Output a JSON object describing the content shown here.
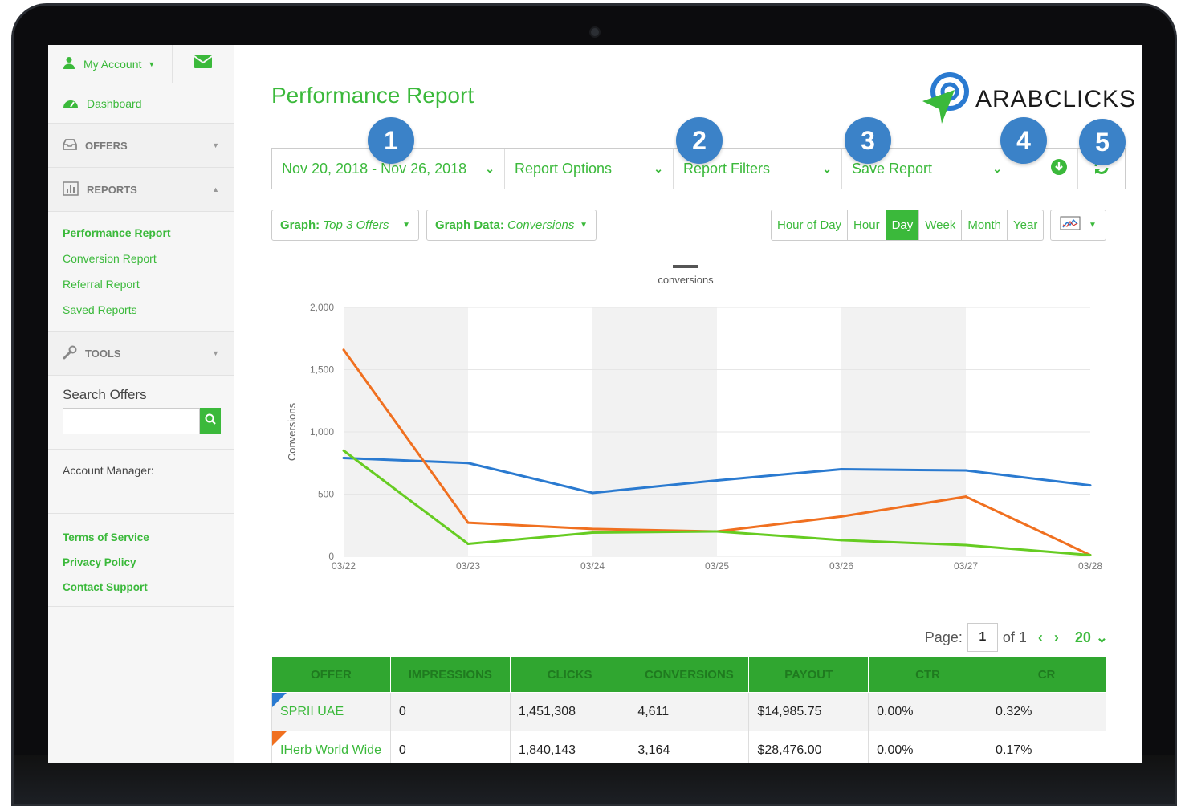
{
  "sidebar": {
    "account_label": "My Account",
    "dashboard_label": "Dashboard",
    "offers_label": "OFFERS",
    "reports_label": "REPORTS",
    "report_items": [
      "Performance Report",
      "Conversion Report",
      "Referral Report",
      "Saved Reports"
    ],
    "tools_label": "TOOLS",
    "search_label": "Search Offers",
    "search_value": "",
    "account_manager_label": "Account Manager:",
    "footer_links": [
      "Terms of Service",
      "Privacy Policy",
      "Contact Support"
    ]
  },
  "header": {
    "title": "Performance Report",
    "logo_text": "ARABCLICKS"
  },
  "toolbar": {
    "date_range": "Nov 20, 2018 - Nov 26, 2018",
    "report_options": "Report Options",
    "report_filters": "Report Filters",
    "save_report": "Save Report",
    "badges": [
      "1",
      "2",
      "3",
      "4",
      "5"
    ]
  },
  "controls": {
    "graph_label": "Graph:",
    "graph_value": "Top 3 Offers",
    "graph_data_label": "Graph Data:",
    "graph_data_value": "Conversions",
    "periods": [
      "Hour of Day",
      "Hour",
      "Day",
      "Week",
      "Month",
      "Year"
    ],
    "active_period": "Day"
  },
  "chart_data": {
    "type": "line",
    "legend": "conversions",
    "ylabel": "Conversions",
    "ylim": [
      0,
      2000
    ],
    "yticks": [
      "0",
      "500",
      "1,000",
      "1,500",
      "2,000"
    ],
    "categories": [
      "03/22",
      "03/23",
      "03/24",
      "03/25",
      "03/26",
      "03/27",
      "03/28"
    ],
    "series": [
      {
        "color": "#2a7ad0",
        "values": [
          790,
          750,
          510,
          610,
          700,
          690,
          570
        ]
      },
      {
        "color": "#f07020",
        "values": [
          1660,
          270,
          220,
          200,
          320,
          480,
          10
        ]
      },
      {
        "color": "#66cc22",
        "values": [
          850,
          100,
          190,
          200,
          130,
          90,
          10
        ]
      }
    ]
  },
  "pager": {
    "label": "Page:",
    "page": "1",
    "of": "of 1",
    "per_page": "20"
  },
  "table": {
    "headers": [
      "OFFER",
      "IMPRESSIONS",
      "CLICKS",
      "CONVERSIONS",
      "PAYOUT",
      "CTR",
      "CR"
    ],
    "rows": [
      {
        "offer": "SPRII UAE",
        "flag": "#2a7ad0",
        "cells": [
          "0",
          "1,451,308",
          "4,611",
          "$14,985.75",
          "0.00%",
          "0.32%"
        ]
      },
      {
        "offer": "IHerb World Wide",
        "flag": "#f07020",
        "cells": [
          "0",
          "1,840,143",
          "3,164",
          "$28,476.00",
          "0.00%",
          "0.17%"
        ]
      }
    ]
  }
}
